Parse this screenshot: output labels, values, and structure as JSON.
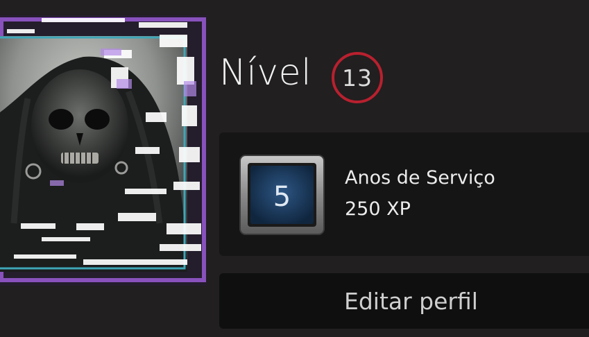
{
  "profile": {
    "level_label": "Nível",
    "level_value": "13",
    "badge": {
      "icon_number": "5",
      "title": "Anos de Serviço",
      "xp": "250 XP"
    },
    "edit_profile_label": "Editar perfil"
  },
  "colors": {
    "background": "#211f1f",
    "card": "#161515",
    "button": "#0f0f0f",
    "level_ring": "#b8202f",
    "avatar_frame_teal": "#3ea6b8",
    "avatar_frame_purple": "#9a5ad6",
    "badge_panel": "#1f3f63"
  }
}
